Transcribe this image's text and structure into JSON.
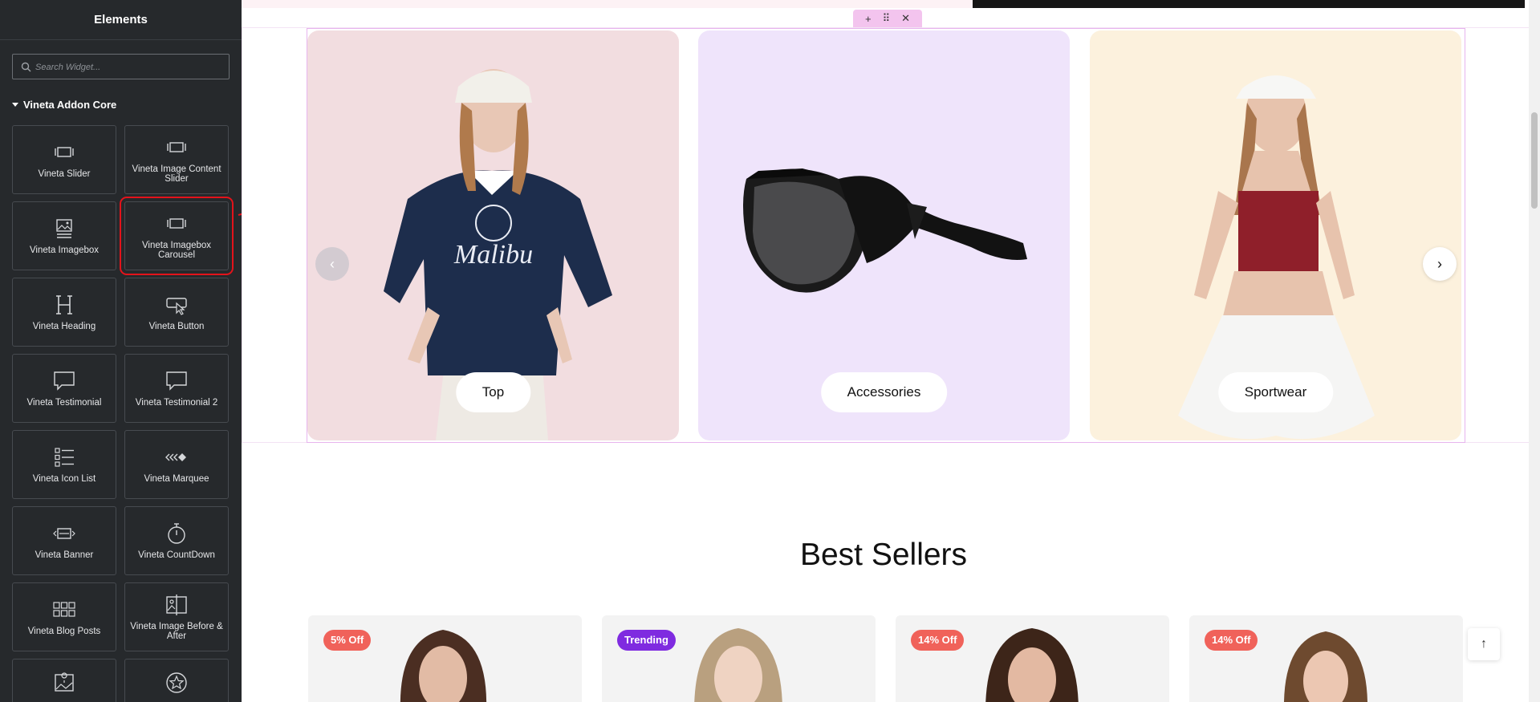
{
  "sidebar": {
    "title": "Elements",
    "search_placeholder": "Search Widget...",
    "section_label": "Vineta Addon Core",
    "widgets": [
      {
        "label": "Vineta Slider",
        "icon": "slider-icon"
      },
      {
        "label": "Vineta Image Content Slider",
        "icon": "slider-icon"
      },
      {
        "label": "Vineta Imagebox",
        "icon": "image-icon"
      },
      {
        "label": "Vineta Imagebox Carousel",
        "icon": "slider-icon"
      },
      {
        "label": "Vineta Heading",
        "icon": "heading-icon"
      },
      {
        "label": "Vineta Button",
        "icon": "button-icon"
      },
      {
        "label": "Vineta Testimonial",
        "icon": "speech-bubble-icon"
      },
      {
        "label": "Vineta Testimonial 2",
        "icon": "speech-bubble-icon"
      },
      {
        "label": "Vineta Icon List",
        "icon": "list-icon"
      },
      {
        "label": "Vineta Marquee",
        "icon": "marquee-icon"
      },
      {
        "label": "Vineta Banner",
        "icon": "banner-icon"
      },
      {
        "label": "Vineta CountDown",
        "icon": "stopwatch-icon"
      },
      {
        "label": "Vineta Blog Posts",
        "icon": "grid-icon"
      },
      {
        "label": "Vineta Image Before & After",
        "icon": "before-after-icon"
      },
      {
        "label": "",
        "icon": "map-image-icon"
      },
      {
        "label": "",
        "icon": "star-icon"
      }
    ]
  },
  "canvas": {
    "carousel": {
      "cards": [
        {
          "label": "Top",
          "bg": "#f2dde0"
        },
        {
          "label": "Accessories",
          "bg": "#efe4fb"
        },
        {
          "label": "Sportwear",
          "bg": "#fcf1dd"
        }
      ]
    },
    "best_sellers_title": "Best Sellers",
    "products": [
      {
        "badge": "5% Off",
        "badge_color": "#f0625a"
      },
      {
        "badge": "Trending",
        "badge_color": "#7f2be0"
      },
      {
        "badge": "14% Off",
        "badge_color": "#f0625a"
      },
      {
        "badge": "14% Off",
        "badge_color": "#f0625a"
      }
    ]
  }
}
